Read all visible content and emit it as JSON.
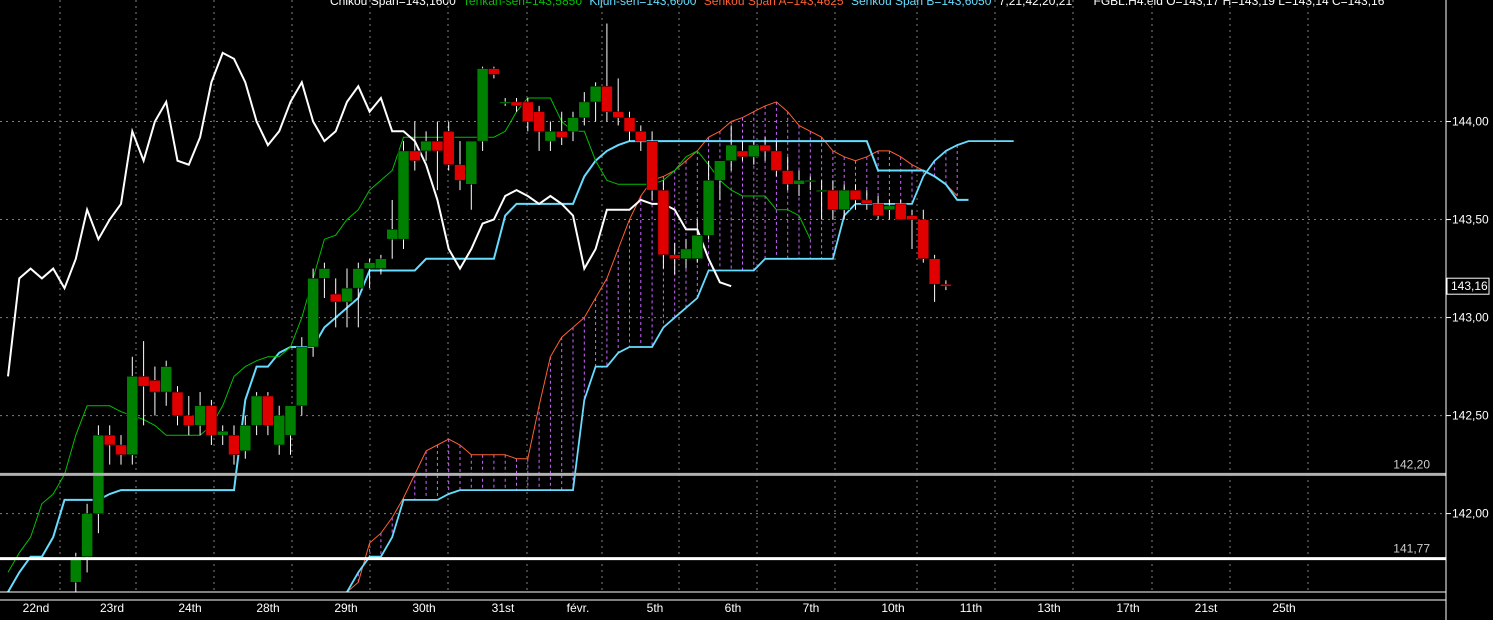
{
  "header": {
    "chikou": "Chikou Span=143,1600",
    "tenkan": "Tenkan-sen=143,5850",
    "kijun": "Kijun-sen=143,6000",
    "senkou_a": "Senkou Span A=143,4625",
    "senkou_b": "Senkou Span B=143,6050",
    "time": "7,21,42,20,21",
    "ohlc": "FGBL.H4.eld O=143,17 H=143,19 L=143,14 C=143,16"
  },
  "colors": {
    "background": "#000000",
    "up_candle": "#008000",
    "down_candle": "#e00000",
    "tenkan": "#00c000",
    "kijun": "#66ddff",
    "chikou": "#ffffff",
    "senkou_a": "#ff6030",
    "senkou_b": "#66ddff",
    "cloud_hatch": "#cc66ff",
    "grid": "#808080"
  },
  "chart_data": {
    "type": "candlestick",
    "instrument": "FGBL",
    "ylim": [
      141.6,
      144.62
    ],
    "yticks": [
      "144,00",
      "143,50",
      "143,00",
      "142,50",
      "142,00"
    ],
    "ytick_values": [
      144.0,
      143.5,
      143.0,
      142.5,
      142.0
    ],
    "last_price_label": "143,16",
    "last_price": 143.16,
    "levels": [
      {
        "label": "142,20",
        "value": 142.2,
        "color": "#b0b0b0"
      },
      {
        "label": "141,77",
        "value": 141.77,
        "color": "#ffffff"
      }
    ],
    "xlabels": [
      "22nd",
      "23rd",
      "24th",
      "28th",
      "29th",
      "30th",
      "31st",
      "févr.",
      "5th",
      "6th",
      "7th",
      "10th",
      "11th",
      "13th",
      "17th",
      "21st",
      "25th"
    ],
    "candles": [
      {
        "o": 141.65,
        "h": 141.8,
        "l": 141.6,
        "c": 141.78
      },
      {
        "o": 141.78,
        "h": 142.05,
        "l": 141.7,
        "c": 142.0
      },
      {
        "o": 142.0,
        "h": 142.45,
        "l": 141.9,
        "c": 142.4
      },
      {
        "o": 142.4,
        "h": 142.45,
        "l": 142.25,
        "c": 142.35
      },
      {
        "o": 142.35,
        "h": 142.4,
        "l": 142.25,
        "c": 142.3
      },
      {
        "o": 142.3,
        "h": 142.8,
        "l": 142.25,
        "c": 142.7
      },
      {
        "o": 142.7,
        "h": 142.88,
        "l": 142.45,
        "c": 142.65
      },
      {
        "o": 142.68,
        "h": 142.75,
        "l": 142.5,
        "c": 142.62
      },
      {
        "o": 142.62,
        "h": 142.78,
        "l": 142.55,
        "c": 142.75
      },
      {
        "o": 142.62,
        "h": 142.65,
        "l": 142.45,
        "c": 142.5
      },
      {
        "o": 142.5,
        "h": 142.6,
        "l": 142.4,
        "c": 142.45
      },
      {
        "o": 142.45,
        "h": 142.62,
        "l": 142.4,
        "c": 142.55
      },
      {
        "o": 142.55,
        "h": 142.58,
        "l": 142.35,
        "c": 142.4
      },
      {
        "o": 142.4,
        "h": 142.45,
        "l": 142.35,
        "c": 142.42
      },
      {
        "o": 142.4,
        "h": 142.45,
        "l": 142.25,
        "c": 142.3
      },
      {
        "o": 142.32,
        "h": 142.5,
        "l": 142.28,
        "c": 142.45
      },
      {
        "o": 142.45,
        "h": 142.62,
        "l": 142.4,
        "c": 142.6
      },
      {
        "o": 142.6,
        "h": 142.62,
        "l": 142.4,
        "c": 142.45
      },
      {
        "o": 142.35,
        "h": 142.55,
        "l": 142.3,
        "c": 142.5
      },
      {
        "o": 142.4,
        "h": 142.55,
        "l": 142.3,
        "c": 142.55
      },
      {
        "o": 142.55,
        "h": 142.9,
        "l": 142.5,
        "c": 142.85
      },
      {
        "o": 142.85,
        "h": 143.25,
        "l": 142.8,
        "c": 143.2
      },
      {
        "o": 143.2,
        "h": 143.28,
        "l": 143.1,
        "c": 143.25
      },
      {
        "o": 143.12,
        "h": 143.2,
        "l": 142.95,
        "c": 143.08
      },
      {
        "o": 143.08,
        "h": 143.25,
        "l": 142.95,
        "c": 143.15
      },
      {
        "o": 143.15,
        "h": 143.28,
        "l": 142.95,
        "c": 143.25
      },
      {
        "o": 143.25,
        "h": 143.3,
        "l": 143.15,
        "c": 143.28
      },
      {
        "o": 143.25,
        "h": 143.32,
        "l": 143.22,
        "c": 143.3
      },
      {
        "o": 143.4,
        "h": 143.6,
        "l": 143.3,
        "c": 143.45
      },
      {
        "o": 143.4,
        "h": 143.9,
        "l": 143.35,
        "c": 143.85
      },
      {
        "o": 143.85,
        "h": 144.0,
        "l": 143.75,
        "c": 143.8
      },
      {
        "o": 143.85,
        "h": 143.95,
        "l": 143.8,
        "c": 143.9
      },
      {
        "o": 143.9,
        "h": 144.0,
        "l": 143.65,
        "c": 143.85
      },
      {
        "o": 143.95,
        "h": 144.0,
        "l": 143.75,
        "c": 143.78
      },
      {
        "o": 143.78,
        "h": 143.9,
        "l": 143.65,
        "c": 143.7
      },
      {
        "o": 143.68,
        "h": 143.75,
        "l": 143.55,
        "c": 143.9
      },
      {
        "o": 143.9,
        "h": 144.28,
        "l": 143.85,
        "c": 144.27
      },
      {
        "o": 144.27,
        "h": 144.28,
        "l": 144.22,
        "c": 144.24
      },
      {
        "o": 144.1,
        "h": 144.12,
        "l": 144.08,
        "c": 144.1
      },
      {
        "o": 144.1,
        "h": 144.12,
        "l": 144.05,
        "c": 144.08
      },
      {
        "o": 144.1,
        "h": 144.12,
        "l": 143.95,
        "c": 144.0
      },
      {
        "o": 144.05,
        "h": 144.08,
        "l": 143.85,
        "c": 143.95
      },
      {
        "o": 143.9,
        "h": 144.0,
        "l": 143.85,
        "c": 143.95
      },
      {
        "o": 143.95,
        "h": 144.05,
        "l": 143.88,
        "c": 143.92
      },
      {
        "o": 143.95,
        "h": 144.05,
        "l": 143.9,
        "c": 144.02
      },
      {
        "o": 144.02,
        "h": 144.15,
        "l": 143.98,
        "c": 144.1
      },
      {
        "o": 144.1,
        "h": 144.2,
        "l": 144.0,
        "c": 144.18
      },
      {
        "o": 144.18,
        "h": 144.5,
        "l": 144.0,
        "c": 144.05
      },
      {
        "o": 144.05,
        "h": 144.22,
        "l": 143.98,
        "c": 144.02
      },
      {
        "o": 144.02,
        "h": 144.05,
        "l": 143.9,
        "c": 143.95
      },
      {
        "o": 143.95,
        "h": 143.98,
        "l": 143.85,
        "c": 143.9
      },
      {
        "o": 143.9,
        "h": 143.95,
        "l": 143.6,
        "c": 143.65
      },
      {
        "o": 143.65,
        "h": 143.7,
        "l": 143.25,
        "c": 143.32
      },
      {
        "o": 143.32,
        "h": 143.38,
        "l": 143.22,
        "c": 143.3
      },
      {
        "o": 143.3,
        "h": 143.4,
        "l": 143.25,
        "c": 143.35
      },
      {
        "o": 143.3,
        "h": 143.5,
        "l": 143.28,
        "c": 143.42
      },
      {
        "o": 143.42,
        "h": 143.8,
        "l": 143.4,
        "c": 143.7
      },
      {
        "o": 143.7,
        "h": 143.8,
        "l": 143.6,
        "c": 143.8
      },
      {
        "o": 143.8,
        "h": 143.98,
        "l": 143.75,
        "c": 143.88
      },
      {
        "o": 143.85,
        "h": 143.9,
        "l": 143.8,
        "c": 143.82
      },
      {
        "o": 143.82,
        "h": 143.9,
        "l": 143.78,
        "c": 143.88
      },
      {
        "o": 143.88,
        "h": 143.92,
        "l": 143.8,
        "c": 143.85
      },
      {
        "o": 143.85,
        "h": 143.9,
        "l": 143.72,
        "c": 143.75
      },
      {
        "o": 143.75,
        "h": 143.82,
        "l": 143.65,
        "c": 143.68
      },
      {
        "o": 143.68,
        "h": 143.75,
        "l": 143.62,
        "c": 143.7
      },
      {
        "o": 143.7,
        "h": 143.72,
        "l": 143.65,
        "c": 143.7
      },
      {
        "o": 143.65,
        "h": 143.7,
        "l": 143.5,
        "c": 143.65
      },
      {
        "o": 143.65,
        "h": 143.7,
        "l": 143.5,
        "c": 143.55
      },
      {
        "o": 143.55,
        "h": 143.68,
        "l": 143.5,
        "c": 143.65
      },
      {
        "o": 143.65,
        "h": 143.68,
        "l": 143.55,
        "c": 143.6
      },
      {
        "o": 143.6,
        "h": 143.65,
        "l": 143.55,
        "c": 143.58
      },
      {
        "o": 143.58,
        "h": 143.62,
        "l": 143.5,
        "c": 143.52
      },
      {
        "o": 143.55,
        "h": 143.6,
        "l": 143.5,
        "c": 143.57
      },
      {
        "o": 143.58,
        "h": 143.6,
        "l": 143.5,
        "c": 143.5
      },
      {
        "o": 143.52,
        "h": 143.55,
        "l": 143.35,
        "c": 143.5
      },
      {
        "o": 143.5,
        "h": 143.55,
        "l": 143.28,
        "c": 143.3
      },
      {
        "o": 143.3,
        "h": 143.32,
        "l": 143.08,
        "c": 143.17
      },
      {
        "o": 143.17,
        "h": 143.19,
        "l": 143.14,
        "c": 143.16
      }
    ],
    "tenkan": [
      141.7,
      141.8,
      141.88,
      142.05,
      142.1,
      142.2,
      142.4,
      142.55,
      142.55,
      142.55,
      142.52,
      142.5,
      142.48,
      142.45,
      142.4,
      142.4,
      142.4,
      142.4,
      142.45,
      142.55,
      142.7,
      142.75,
      142.78,
      142.8,
      142.8,
      142.85,
      143.0,
      143.2,
      143.4,
      143.42,
      143.5,
      143.55,
      143.65,
      143.7,
      143.75,
      143.92,
      143.92,
      143.92,
      143.92,
      143.92,
      143.92,
      143.92,
      143.92,
      143.92,
      143.95,
      144.05,
      144.12,
      144.12,
      144.12,
      144.0,
      143.95,
      143.95,
      143.8,
      143.7,
      143.68,
      143.68,
      143.68,
      143.68,
      143.7,
      143.75,
      143.82,
      143.85,
      143.78,
      143.7,
      143.65,
      143.62,
      143.62,
      143.62,
      143.55,
      143.55,
      143.52,
      143.4
    ],
    "kijun": [
      141.6,
      141.7,
      141.78,
      141.78,
      141.88,
      142.07,
      142.07,
      142.07,
      142.07,
      142.1,
      142.12,
      142.12,
      142.12,
      142.12,
      142.12,
      142.12,
      142.12,
      142.12,
      142.12,
      142.12,
      142.12,
      142.58,
      142.75,
      142.75,
      142.82,
      142.85,
      142.85,
      142.85,
      142.95,
      143.0,
      143.05,
      143.1,
      143.24,
      143.24,
      143.24,
      143.24,
      143.24,
      143.3,
      143.3,
      143.3,
      143.3,
      143.3,
      143.3,
      143.3,
      143.52,
      143.58,
      143.58,
      143.58,
      143.58,
      143.58,
      143.58,
      143.72,
      143.8,
      143.85,
      143.88,
      143.9,
      143.9,
      143.9,
      143.9,
      143.9,
      143.9,
      143.9,
      143.9,
      143.9,
      143.9,
      143.9,
      143.9,
      143.9,
      143.9,
      143.9,
      143.9,
      143.9,
      143.9,
      143.9,
      143.9,
      143.9,
      143.9,
      143.75,
      143.75,
      143.75,
      143.75,
      143.75,
      143.72,
      143.68,
      143.6,
      143.6
    ],
    "chikou": [
      142.7,
      143.2,
      143.25,
      143.2,
      143.25,
      143.15,
      143.3,
      143.55,
      143.4,
      143.5,
      143.58,
      143.95,
      143.8,
      144.0,
      144.1,
      143.8,
      143.78,
      143.92,
      144.2,
      144.35,
      144.32,
      144.2,
      144.0,
      143.88,
      143.95,
      144.1,
      144.2,
      144.0,
      143.9,
      143.95,
      144.1,
      144.18,
      144.05,
      144.12,
      143.95,
      143.95,
      143.9,
      143.78,
      143.6,
      143.35,
      143.25,
      143.35,
      143.48,
      143.5,
      143.62,
      143.65,
      143.62,
      143.58,
      143.62,
      143.58,
      143.52,
      143.25,
      143.35,
      143.55,
      143.55,
      143.55,
      143.6,
      143.58,
      143.58,
      143.55,
      143.45,
      143.45,
      143.3,
      143.18,
      143.16
    ]
  }
}
